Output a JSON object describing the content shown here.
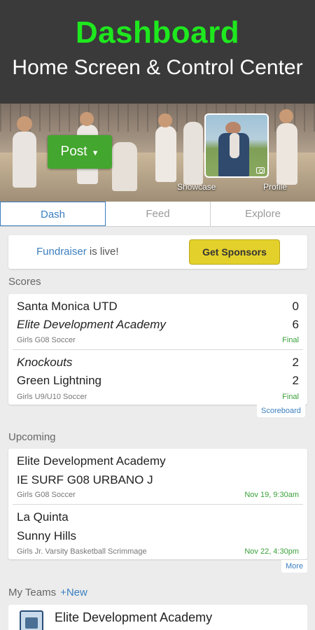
{
  "promo": {
    "title": "Dashboard",
    "subtitle": "Home Screen & Control Center"
  },
  "hero": {
    "post_label": "Post",
    "showcase_label": "Showcase",
    "profile_label": "Profile"
  },
  "tabs": [
    "Dash",
    "Feed",
    "Explore"
  ],
  "active_tab": "Dash",
  "fundraiser": {
    "link_text": "Fundraiser",
    "text": " is live!",
    "button": "Get Sponsors"
  },
  "scores": {
    "header": "Scores",
    "games": [
      {
        "team1": "Santa Monica UTD",
        "score1": "0",
        "team2": "Elite Development Academy",
        "score2": "6",
        "league": "Girls G08 Soccer",
        "status": "Final"
      },
      {
        "team1": "Knockouts",
        "score1": "2",
        "team2": "Green Lightning",
        "score2": "2",
        "league": "Girls U9/U10 Soccer",
        "status": "Final"
      }
    ],
    "link": "Scoreboard"
  },
  "upcoming": {
    "header": "Upcoming",
    "games": [
      {
        "team1": "Elite Development Academy",
        "team2": "IE SURF G08 URBANO J",
        "league": "Girls G08 Soccer",
        "time": "Nov 19, 9:30am"
      },
      {
        "team1": "La Quinta",
        "team2": "Sunny Hills",
        "league": "Girls Jr. Varsity Basketball Scrimmage",
        "time": "Nov 22, 4:30pm"
      }
    ],
    "link": "More"
  },
  "my_teams": {
    "header": "My Teams",
    "new_label": "+New",
    "teams": [
      {
        "name": "Elite Development Academy"
      }
    ]
  },
  "colors": {
    "accent": "#3a7fc0",
    "promo_title": "#1ee81e",
    "post_button": "#43a62e",
    "sponsor_button": "#e3d02b",
    "status_green": "#3aa13a"
  }
}
